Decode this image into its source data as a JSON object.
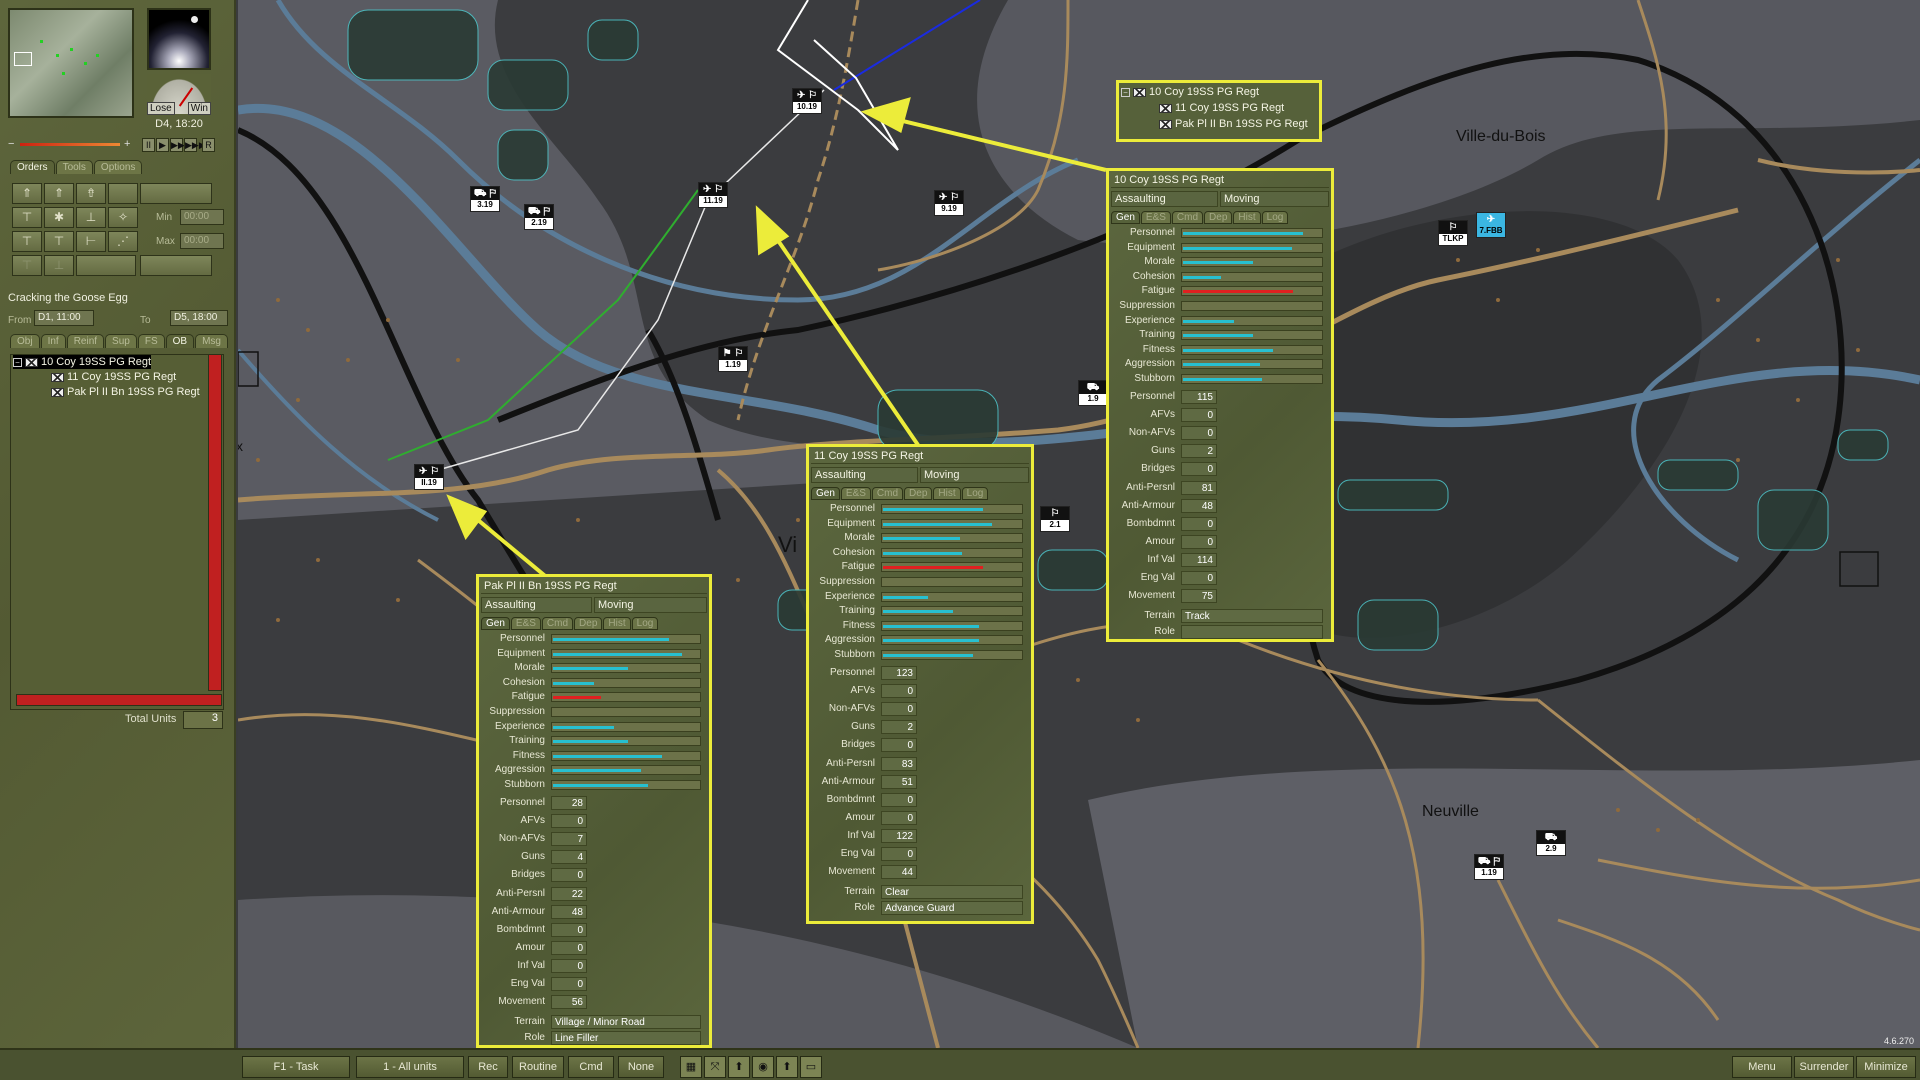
{
  "left_panel": {
    "gauge": {
      "lose": "Lose",
      "win": "Win"
    },
    "turn": "D4, 18:20",
    "vcr": [
      "II",
      "▶",
      "▶▶",
      "▶▶▶",
      "R"
    ],
    "tabs": [
      "Orders",
      "Tools",
      "Options"
    ],
    "min_label": "Min",
    "min_value": "00:00",
    "max_label": "Max",
    "max_value": "00:00",
    "scenario": "Cracking the Goose Egg",
    "from_label": "From",
    "from_value": "D1, 11:00",
    "to_label": "To",
    "to_value": "D5, 18:00",
    "info_tabs": [
      "Obj",
      "Inf",
      "Reinf",
      "Sup",
      "FS",
      "OB",
      "Msg"
    ],
    "tree": [
      {
        "label": "10 Coy 19SS PG Regt",
        "selected": true
      },
      {
        "label": "11 Coy 19SS PG Regt",
        "selected": false
      },
      {
        "label": "Pak Pl II Bn 19SS PG Regt",
        "selected": false
      }
    ],
    "total_units_label": "Total Units",
    "total_units": "3"
  },
  "map": {
    "places": [
      "Ville-du-Bois",
      "Neuville",
      "Vi",
      "x"
    ],
    "units": [
      {
        "id": "u1",
        "label": "10.19"
      },
      {
        "id": "u2",
        "label": "11.19"
      },
      {
        "id": "u3",
        "label": "9.19"
      },
      {
        "id": "u4",
        "label": "3.19"
      },
      {
        "id": "u5",
        "label": "2.19"
      },
      {
        "id": "u6",
        "label": "1.19"
      },
      {
        "id": "u7",
        "label": "II.19"
      },
      {
        "id": "u8",
        "label": "1.9"
      },
      {
        "id": "u9",
        "label": "2.1"
      },
      {
        "id": "u10",
        "label": "TLKP"
      },
      {
        "id": "u11",
        "label": "7.FBB"
      },
      {
        "id": "u12",
        "label": "2.9"
      },
      {
        "id": "u13",
        "label": "1.19"
      }
    ],
    "colors": {
      "highlight": "#ecec3a",
      "road": "#a88a5c",
      "river": "#5b7c98"
    }
  },
  "top_tree": [
    {
      "label": "10 Coy 19SS PG Regt"
    },
    {
      "label": "11 Coy 19SS PG Regt"
    },
    {
      "label": "Pak Pl II Bn 19SS PG Regt"
    }
  ],
  "unit_panels": [
    {
      "title": "10 Coy 19SS PG Regt",
      "status": "Assaulting",
      "move_status": "Moving",
      "tabs": [
        "Gen",
        "E&S",
        "Cmd",
        "Dep",
        "Hist",
        "Log"
      ],
      "bars": [
        {
          "name": "Personnel",
          "value": 0.94,
          "red": false
        },
        {
          "name": "Equipment",
          "value": 0.85,
          "red": false
        },
        {
          "name": "Morale",
          "value": 0.55,
          "red": false
        },
        {
          "name": "Cohesion",
          "value": 0.3,
          "red": false
        },
        {
          "name": "Fatigue",
          "value": 0.86,
          "red": true
        },
        {
          "name": "Suppression",
          "value": 0.0,
          "red": false
        },
        {
          "name": "Experience",
          "value": 0.4,
          "red": false
        },
        {
          "name": "Training",
          "value": 0.55,
          "red": false
        },
        {
          "name": "Fitness",
          "value": 0.7,
          "red": false
        },
        {
          "name": "Aggression",
          "value": 0.6,
          "red": false
        },
        {
          "name": "Stubborn",
          "value": 0.62,
          "red": false
        }
      ],
      "numbers": [
        {
          "name": "Personnel",
          "value": "115"
        },
        {
          "name": "AFVs",
          "value": "0"
        },
        {
          "name": "Non-AFVs",
          "value": "0"
        },
        {
          "name": "Guns",
          "value": "2"
        },
        {
          "name": "Bridges",
          "value": "0"
        },
        {
          "name": "Anti-Persnl",
          "value": "81"
        },
        {
          "name": "Anti-Armour",
          "value": "48"
        },
        {
          "name": "Bombdmnt",
          "value": "0"
        },
        {
          "name": "Amour",
          "value": "0"
        },
        {
          "name": "Inf Val",
          "value": "114"
        },
        {
          "name": "Eng Val",
          "value": "0"
        },
        {
          "name": "Movement",
          "value": "75"
        }
      ],
      "terrain_label": "Terrain",
      "terrain": "Track",
      "role_label": "Role",
      "role": ""
    },
    {
      "title": "11 Coy 19SS PG Regt",
      "status": "Assaulting",
      "move_status": "Moving",
      "tabs": [
        "Gen",
        "E&S",
        "Cmd",
        "Dep",
        "Hist",
        "Log"
      ],
      "bars": [
        {
          "name": "Personnel",
          "value": 0.78,
          "red": false
        },
        {
          "name": "Equipment",
          "value": 0.85,
          "red": false
        },
        {
          "name": "Morale",
          "value": 0.6,
          "red": false
        },
        {
          "name": "Cohesion",
          "value": 0.62,
          "red": false
        },
        {
          "name": "Fatigue",
          "value": 0.78,
          "red": true
        },
        {
          "name": "Suppression",
          "value": 0.0,
          "red": false
        },
        {
          "name": "Experience",
          "value": 0.35,
          "red": false
        },
        {
          "name": "Training",
          "value": 0.55,
          "red": false
        },
        {
          "name": "Fitness",
          "value": 0.75,
          "red": false
        },
        {
          "name": "Aggression",
          "value": 0.75,
          "red": false
        },
        {
          "name": "Stubborn",
          "value": 0.7,
          "red": false
        }
      ],
      "numbers": [
        {
          "name": "Personnel",
          "value": "123"
        },
        {
          "name": "AFVs",
          "value": "0"
        },
        {
          "name": "Non-AFVs",
          "value": "0"
        },
        {
          "name": "Guns",
          "value": "2"
        },
        {
          "name": "Bridges",
          "value": "0"
        },
        {
          "name": "Anti-Persnl",
          "value": "83"
        },
        {
          "name": "Anti-Armour",
          "value": "51"
        },
        {
          "name": "Bombdmnt",
          "value": "0"
        },
        {
          "name": "Amour",
          "value": "0"
        },
        {
          "name": "Inf Val",
          "value": "122"
        },
        {
          "name": "Eng Val",
          "value": "0"
        },
        {
          "name": "Movement",
          "value": "44"
        }
      ],
      "terrain_label": "Terrain",
      "terrain": "Clear",
      "role_label": "Role",
      "role": "Advance Guard"
    },
    {
      "title": "Pak Pl II Bn 19SS PG Regt",
      "status": "Assaulting",
      "move_status": "Moving",
      "tabs": [
        "Gen",
        "E&S",
        "Cmd",
        "Dep",
        "Hist",
        "Log"
      ],
      "bars": [
        {
          "name": "Personnel",
          "value": 0.85,
          "red": false
        },
        {
          "name": "Equipment",
          "value": 0.95,
          "red": false
        },
        {
          "name": "Morale",
          "value": 0.55,
          "red": false
        },
        {
          "name": "Cohesion",
          "value": 0.3,
          "red": false
        },
        {
          "name": "Fatigue",
          "value": 0.35,
          "red": true
        },
        {
          "name": "Suppression",
          "value": 0.0,
          "red": false
        },
        {
          "name": "Experience",
          "value": 0.45,
          "red": false
        },
        {
          "name": "Training",
          "value": 0.55,
          "red": false
        },
        {
          "name": "Fitness",
          "value": 0.8,
          "red": false
        },
        {
          "name": "Aggression",
          "value": 0.65,
          "red": false
        },
        {
          "name": "Stubborn",
          "value": 0.7,
          "red": false
        }
      ],
      "numbers": [
        {
          "name": "Personnel",
          "value": "28"
        },
        {
          "name": "AFVs",
          "value": "0"
        },
        {
          "name": "Non-AFVs",
          "value": "7"
        },
        {
          "name": "Guns",
          "value": "4"
        },
        {
          "name": "Bridges",
          "value": "0"
        },
        {
          "name": "Anti-Persnl",
          "value": "22"
        },
        {
          "name": "Anti-Armour",
          "value": "48"
        },
        {
          "name": "Bombdmnt",
          "value": "0"
        },
        {
          "name": "Amour",
          "value": "0"
        },
        {
          "name": "Inf Val",
          "value": "0"
        },
        {
          "name": "Eng Val",
          "value": "0"
        },
        {
          "name": "Movement",
          "value": "56"
        }
      ],
      "terrain_label": "Terrain",
      "terrain": "Village / Minor Road",
      "role_label": "Role",
      "role": "Line Filler"
    }
  ],
  "bottom_bar": {
    "task": "F1 - Task",
    "units": "1 - All units",
    "rec": "Rec",
    "routine": "Routine",
    "cmd": "Cmd",
    "none": "None",
    "menu": "Menu",
    "surrender": "Surrender",
    "minimize": "Minimize"
  },
  "version": "4.6.270"
}
